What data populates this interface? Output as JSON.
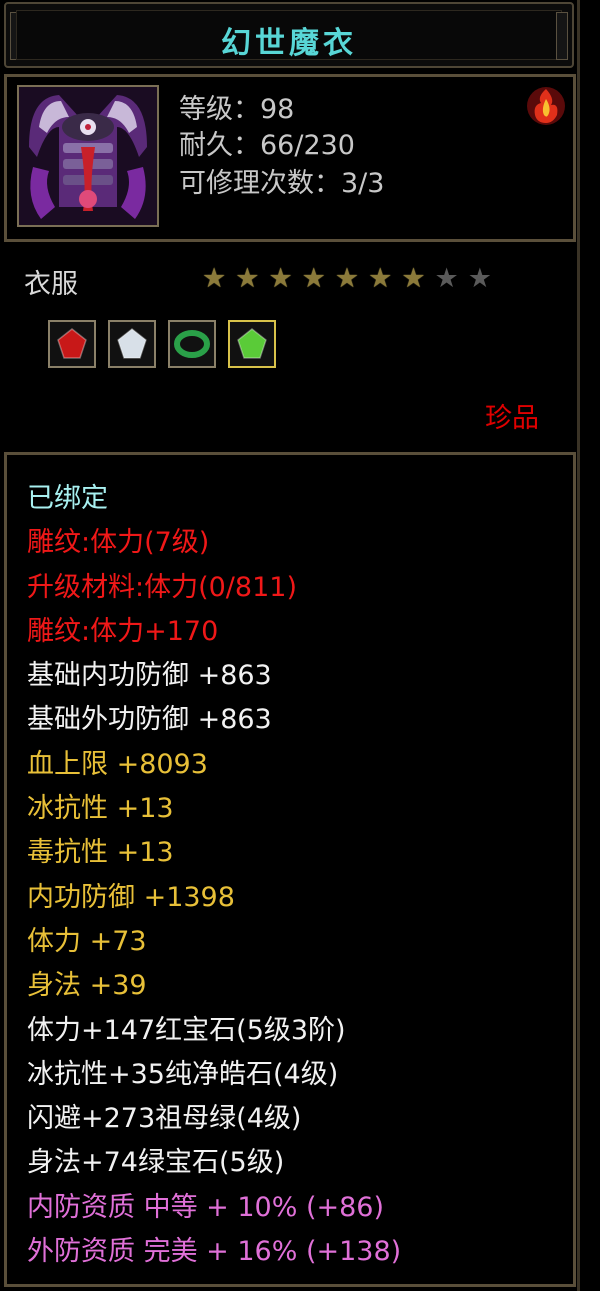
{
  "item": {
    "name": "幻世魔衣",
    "level_line": "等级：98",
    "durability_line": "耐久：66/230",
    "repair_line": "可修理次数：3/3",
    "type": "衣服",
    "rarity": "珍品",
    "stars_filled": 7,
    "stars_total": 9,
    "portrait_icon": "demon-robe-icon",
    "badge_icon": "flame-emblem-icon"
  },
  "gems": [
    {
      "icon": "ruby-icon",
      "color": "#c81818",
      "selected": false
    },
    {
      "icon": "diamond-icon",
      "color": "#d8e0e8",
      "selected": false
    },
    {
      "icon": "emerald-ring-icon",
      "color": "#2aa048",
      "selected": false
    },
    {
      "icon": "green-gem-icon",
      "color": "#5acb38",
      "selected": true
    }
  ],
  "stats": [
    {
      "text": "已绑定",
      "color": "cyan"
    },
    {
      "text": "雕纹:体力(7级)",
      "color": "red"
    },
    {
      "text": "升级材料:体力(0/811)",
      "color": "red"
    },
    {
      "text": "雕纹:体力+170",
      "color": "red"
    },
    {
      "text": "基础内功防御 +863",
      "color": "white"
    },
    {
      "text": "基础外功防御 +863",
      "color": "white"
    },
    {
      "text": "血上限 +8093",
      "color": "gold"
    },
    {
      "text": "冰抗性 +13",
      "color": "gold"
    },
    {
      "text": "毒抗性 +13",
      "color": "gold"
    },
    {
      "text": "内功防御 +1398",
      "color": "gold"
    },
    {
      "text": "体力 +73",
      "color": "gold"
    },
    {
      "text": "身法 +39",
      "color": "gold"
    },
    {
      "text": "体力+147红宝石(5级3阶)",
      "color": "white"
    },
    {
      "text": "冰抗性+35纯净皓石(4级)",
      "color": "white"
    },
    {
      "text": "闪避+273祖母绿(4级)",
      "color": "white"
    },
    {
      "text": "身法+74绿宝石(5级)",
      "color": "white"
    },
    {
      "text": "内防资质 中等 + 10% (+86)",
      "color": "pink"
    },
    {
      "text": "外防资质 完美 + 16% (+138)",
      "color": "pink"
    }
  ]
}
